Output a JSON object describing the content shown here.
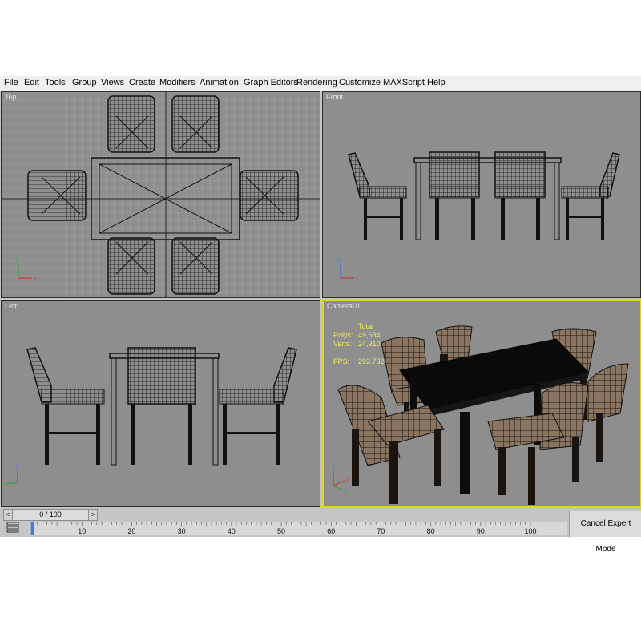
{
  "menu": [
    "File",
    "Edit",
    "Tools",
    "Group",
    "Views",
    "Create",
    "Modifiers",
    "Animation",
    "Graph Editors",
    "Rendering",
    "Customize",
    "MAXScript",
    "Help"
  ],
  "viewports": {
    "top": {
      "label": "Top"
    },
    "front": {
      "label": "Front"
    },
    "left": {
      "label": "Left"
    },
    "camera": {
      "label": "Camera01"
    }
  },
  "stats": {
    "header": "Total",
    "polys_label": "Polys:",
    "polys_value": "49,634",
    "verts_label": "Verts:",
    "verts_value": "24,910",
    "fps_label": "FPS:",
    "fps_value": "293.732"
  },
  "axis": {
    "x": "x",
    "y": "y",
    "z": "z"
  },
  "time_slider": {
    "value": "0 / 100",
    "left_arrow": "<",
    "right_arrow": ">"
  },
  "track_labels": [
    "10",
    "20",
    "30",
    "40",
    "50",
    "60",
    "70",
    "80",
    "90",
    "100"
  ],
  "cancel_expert_label": "Cancel Expert Mode",
  "colors": {
    "active_viewport": "#e3d22d",
    "viewport_bg": "#8e8e8e",
    "stats_text": "#f3f05a"
  }
}
